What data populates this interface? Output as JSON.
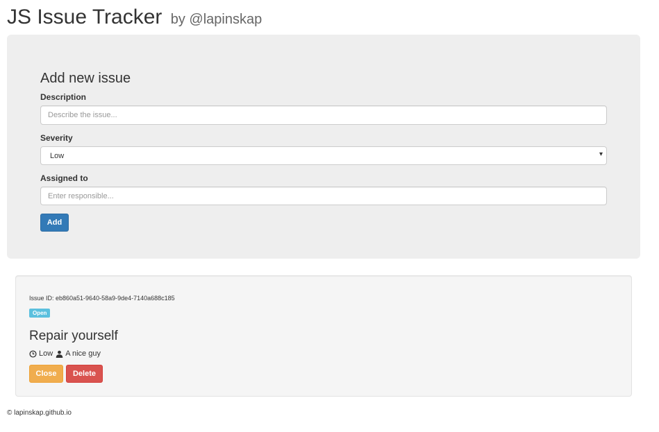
{
  "header": {
    "title": "JS Issue Tracker",
    "subtitle": "by @lapinskap"
  },
  "form": {
    "heading": "Add new issue",
    "description": {
      "label": "Description",
      "placeholder": "Describe the issue..."
    },
    "severity": {
      "label": "Severity",
      "value": "Low",
      "caret": "▾"
    },
    "assigned": {
      "label": "Assigned to",
      "placeholder": "Enter responsible..."
    },
    "add_label": "Add"
  },
  "issue": {
    "id_label": "Issue ID: eb860a51-9640-58a9-9de4-7140a688c185",
    "status": "Open",
    "title": "Repair yourself",
    "severity": "Low",
    "assignee": "A nice guy",
    "close_label": "Close",
    "delete_label": "Delete"
  },
  "footer": {
    "text": "© lapinskap.github.io"
  },
  "colors": {
    "primary": "#337ab7",
    "warning": "#f0ad4e",
    "danger": "#d9534f",
    "info": "#5bc0de",
    "panel": "#eeeeee"
  },
  "icons": {
    "severity": "clock-icon",
    "assignee": "user-icon"
  }
}
